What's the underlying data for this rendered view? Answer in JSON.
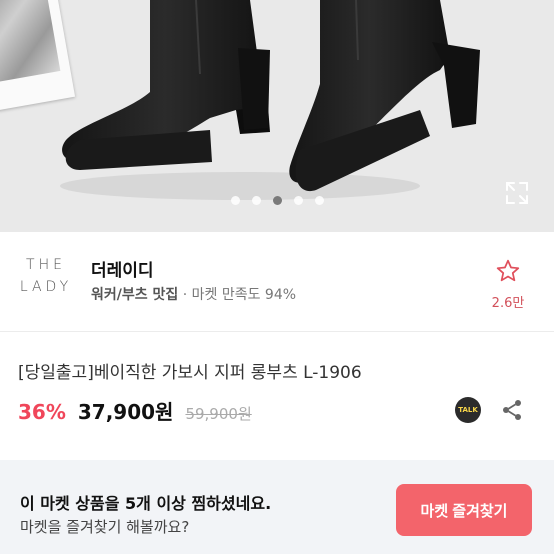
{
  "carousel": {
    "dots": 5,
    "active_index": 2
  },
  "shop": {
    "logo_line1": "THE",
    "logo_line2": "LADY",
    "name": "더레이디",
    "category": "워커/부츠 맛집",
    "satisfaction": "· 마켓 만족도 94%",
    "favorite_count": "2.6만"
  },
  "product": {
    "title": "[당일출고]베이직한 가보시 지퍼 롱부츠 L-1906",
    "discount": "36%",
    "price": "37,900원",
    "original_price": "59,900원",
    "talk_label": "TALK"
  },
  "banner": {
    "line1": "이 마켓 상품을 5개 이상 찜하셨네요.",
    "line2": "마켓을 즐겨찾기 해볼까요?",
    "button_label": "마켓 즐겨찾기"
  },
  "colors": {
    "accent": "#f0465a",
    "button": "#f3646b",
    "banner_bg": "#f2f4f7"
  },
  "icons": {
    "expand": "expand-icon",
    "favorite": "star-outline-icon",
    "talk": "kakao-talk-icon",
    "share": "share-icon"
  }
}
